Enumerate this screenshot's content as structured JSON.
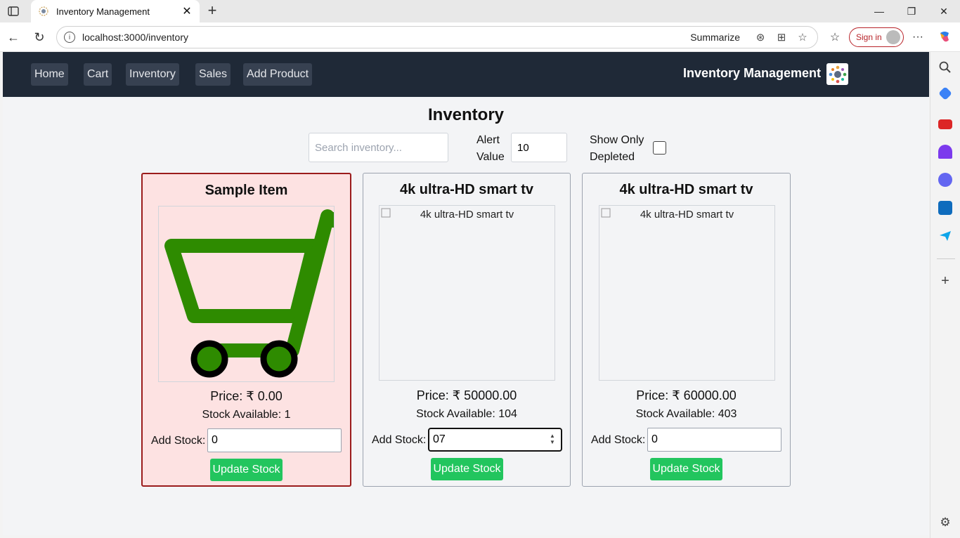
{
  "browser": {
    "tab_title": "Inventory Management",
    "url": "localhost:3000/inventory",
    "summarize_label": "Summarize",
    "signin_label": "Sign in"
  },
  "nav": {
    "links": [
      "Home",
      "Cart",
      "Inventory",
      "Sales",
      "Add Product"
    ],
    "brand": "Inventory Management"
  },
  "page": {
    "title": "Inventory",
    "search_placeholder": "Search inventory...",
    "alert_label": "Alert Value",
    "alert_value": "10",
    "depleted_label": "Show Only Depleted",
    "depleted_checked": false
  },
  "cards": [
    {
      "name": "Sample Item",
      "price": "Price: ₹ 0.00",
      "stock": "Stock Available: 1",
      "add_label": "Add Stock:",
      "add_value": "0",
      "button": "Update Stock",
      "alert": true,
      "image": "shopping-cart-image",
      "image_alt": ""
    },
    {
      "name": "4k ultra-HD smart tv",
      "price": "Price: ₹ 50000.00",
      "stock": "Stock Available: 104",
      "add_label": "Add Stock:",
      "add_value": "07",
      "button": "Update Stock",
      "alert": false,
      "image": "broken-image",
      "image_alt": "4k ultra-HD smart tv"
    },
    {
      "name": "4k ultra-HD smart tv",
      "price": "Price: ₹ 60000.00",
      "stock": "Stock Available: 403",
      "add_label": "Add Stock:",
      "add_value": "0",
      "button": "Update Stock",
      "alert": false,
      "image": "broken-image",
      "image_alt": "4k ultra-HD smart tv"
    }
  ],
  "colors": {
    "navbar": "#1f2937",
    "button_green": "#22c55e",
    "alert_bg": "#fde2e2",
    "alert_border": "#9b1c1c",
    "cart_green": "#2e8b00"
  }
}
